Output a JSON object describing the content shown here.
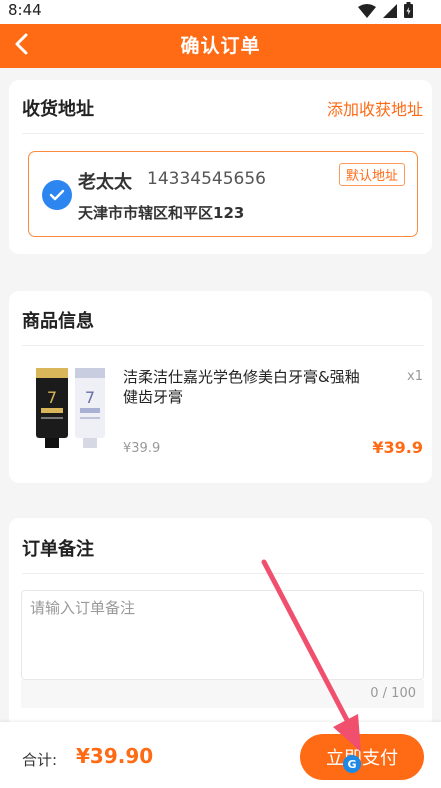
{
  "status_bar": {
    "time": "8:44"
  },
  "header": {
    "title": "确认订单"
  },
  "address": {
    "section_title": "收货地址",
    "add_label": "添加收获地址",
    "name": "老太太",
    "phone": "14334545656",
    "default_tag": "默认地址",
    "detail": "天津市市辖区和平区123"
  },
  "goods": {
    "section_title": "商品信息",
    "items": [
      {
        "name": "洁柔洁仕嘉光学色修美白牙膏&强釉健齿牙膏",
        "qty": "x1",
        "unit_price": "¥39.9",
        "price": "¥39.9"
      }
    ]
  },
  "note": {
    "section_title": "订单备注",
    "placeholder": "请输入订单备注",
    "value": "",
    "count": "0 / 100"
  },
  "footer": {
    "total_label": "合计:",
    "total_amount": "¥39.90",
    "pay_label": "立即支付"
  },
  "colors": {
    "accent": "#ff6a14",
    "check": "#2d86f0",
    "annotation": "#f0506e"
  },
  "icons": [
    "wifi-icon",
    "signal-icon",
    "battery-icon",
    "back-arrow-icon",
    "check-icon",
    "product-image",
    "annotation-arrow"
  ]
}
